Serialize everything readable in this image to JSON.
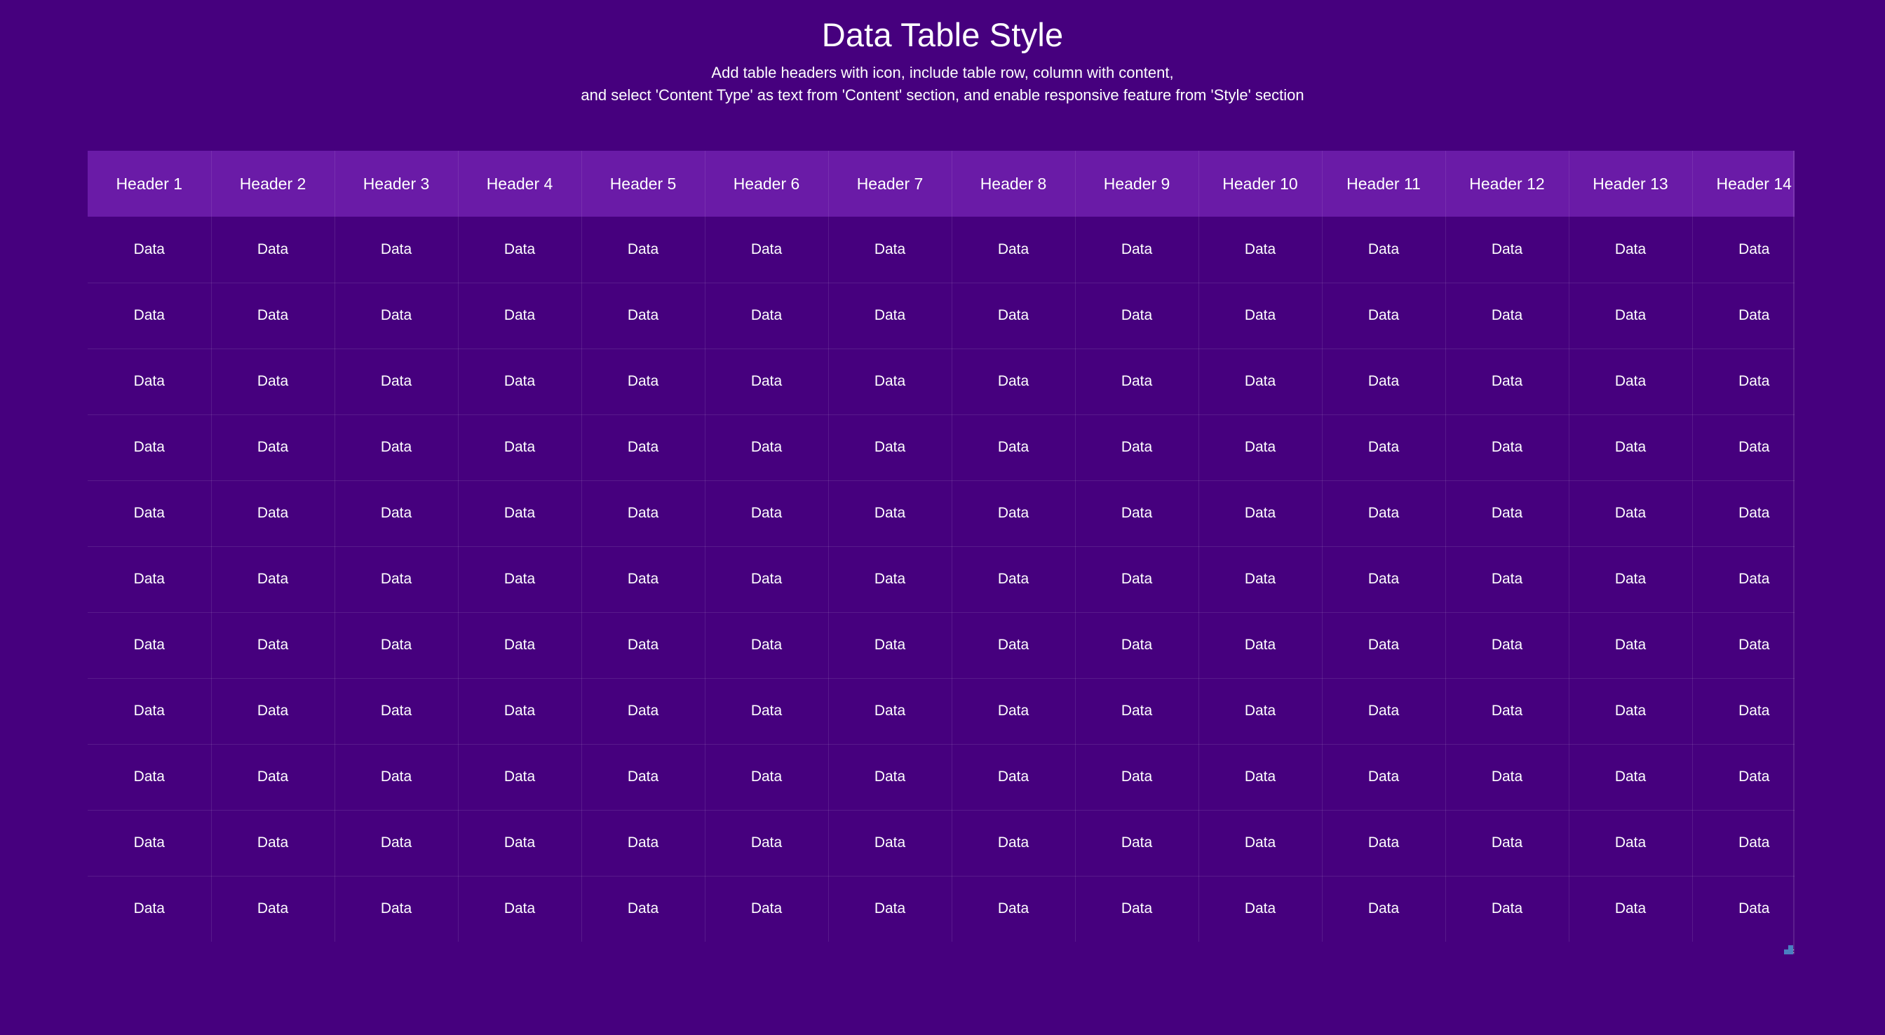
{
  "heading": {
    "title": "Data Table Style",
    "subtitle_line_1": "Add table headers with icon, include table row, column with content,",
    "subtitle_line_2": "and select 'Content Type' as text from 'Content' section, and enable responsive feature from 'Style' section"
  },
  "colors": {
    "page_background": "#46007e",
    "header_background": "#6a1ba7",
    "cell_background": "#46007e",
    "text": "#ffffff",
    "border": "rgba(255,255,255,0.10)",
    "resize_grip": "#4a7fc1"
  },
  "table": {
    "column_count": 14,
    "row_count": 11,
    "responsive": true,
    "headers": [
      "Header 1",
      "Header 2",
      "Header 3",
      "Header 4",
      "Header 5",
      "Header 6",
      "Header 7",
      "Header 8",
      "Header 9",
      "Header 10",
      "Header 11",
      "Header 12",
      "Header 13",
      "Header 14"
    ],
    "cell_text": "Data",
    "rows": [
      [
        "Data",
        "Data",
        "Data",
        "Data",
        "Data",
        "Data",
        "Data",
        "Data",
        "Data",
        "Data",
        "Data",
        "Data",
        "Data",
        "Data"
      ],
      [
        "Data",
        "Data",
        "Data",
        "Data",
        "Data",
        "Data",
        "Data",
        "Data",
        "Data",
        "Data",
        "Data",
        "Data",
        "Data",
        "Data"
      ],
      [
        "Data",
        "Data",
        "Data",
        "Data",
        "Data",
        "Data",
        "Data",
        "Data",
        "Data",
        "Data",
        "Data",
        "Data",
        "Data",
        "Data"
      ],
      [
        "Data",
        "Data",
        "Data",
        "Data",
        "Data",
        "Data",
        "Data",
        "Data",
        "Data",
        "Data",
        "Data",
        "Data",
        "Data",
        "Data"
      ],
      [
        "Data",
        "Data",
        "Data",
        "Data",
        "Data",
        "Data",
        "Data",
        "Data",
        "Data",
        "Data",
        "Data",
        "Data",
        "Data",
        "Data"
      ],
      [
        "Data",
        "Data",
        "Data",
        "Data",
        "Data",
        "Data",
        "Data",
        "Data",
        "Data",
        "Data",
        "Data",
        "Data",
        "Data",
        "Data"
      ],
      [
        "Data",
        "Data",
        "Data",
        "Data",
        "Data",
        "Data",
        "Data",
        "Data",
        "Data",
        "Data",
        "Data",
        "Data",
        "Data",
        "Data"
      ],
      [
        "Data",
        "Data",
        "Data",
        "Data",
        "Data",
        "Data",
        "Data",
        "Data",
        "Data",
        "Data",
        "Data",
        "Data",
        "Data",
        "Data"
      ],
      [
        "Data",
        "Data",
        "Data",
        "Data",
        "Data",
        "Data",
        "Data",
        "Data",
        "Data",
        "Data",
        "Data",
        "Data",
        "Data",
        "Data"
      ],
      [
        "Data",
        "Data",
        "Data",
        "Data",
        "Data",
        "Data",
        "Data",
        "Data",
        "Data",
        "Data",
        "Data",
        "Data",
        "Data",
        "Data"
      ],
      [
        "Data",
        "Data",
        "Data",
        "Data",
        "Data",
        "Data",
        "Data",
        "Data",
        "Data",
        "Data",
        "Data",
        "Data",
        "Data",
        "Data"
      ]
    ]
  }
}
